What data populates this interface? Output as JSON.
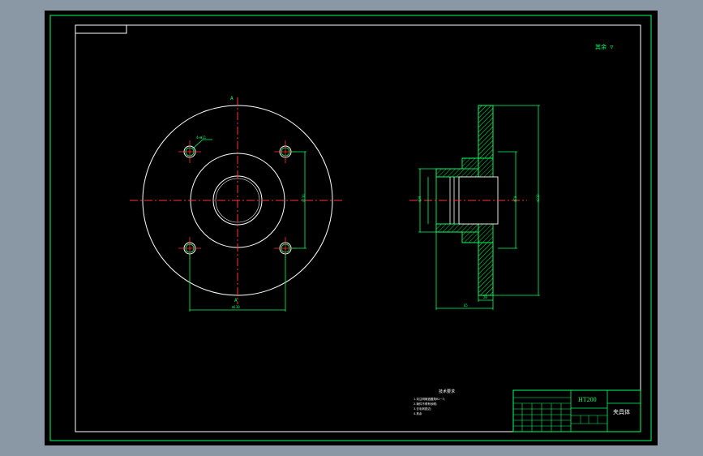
{
  "colors": {
    "background": "#000000",
    "frame": "#00ff66",
    "geometry": "#ffffff",
    "centerline": "#ff3333",
    "dimension": "#00ff66",
    "hatch": "#00cc44",
    "chrome": "#8a98a5"
  },
  "drawing": {
    "roughness_note": "其余 ▽",
    "technical_requirements_title": "技术要求",
    "technical_requirements": [
      "1.未注明铸造圆角R2~3;",
      "2.铸件不得有砂眼;",
      "3.去毛刺锐边;",
      "4.其余"
    ],
    "title_block": {
      "material": "HT200",
      "part_name": "夹具体"
    },
    "front_view": {
      "section_label_top": "A",
      "section_label_bottom": "A",
      "hole_callout": "4×Φ11",
      "dim_horizontal": "Φ130",
      "dim_vertical": "Φ130"
    },
    "section_view": {
      "dim_outer": "Φ210",
      "dim_bore": "Φ70",
      "dim_left": "Φ90",
      "dim_thickness": "20",
      "dim_length": "65"
    }
  }
}
